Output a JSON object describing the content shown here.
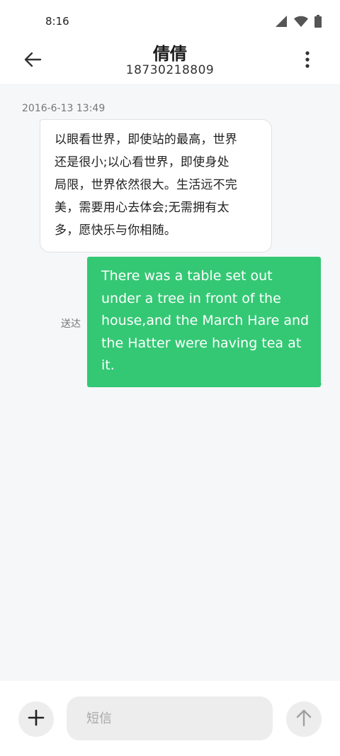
{
  "status_bar": {
    "time": "8:16",
    "icons": [
      "signal-icon",
      "wifi-icon",
      "battery-icon"
    ]
  },
  "header": {
    "contact_name": "倩倩",
    "phone_number": "18730218809",
    "back_icon": "arrow-left-icon",
    "more_icon": "more-vertical-icon"
  },
  "conversation": {
    "messages": [
      {
        "direction": "incoming",
        "timestamp": "2016-6-13 13:49",
        "lines": [
          "以眼看世界，即使站的最高，世界",
          "还是很小;以心看世界，即使身处",
          "局限，世界依然很大。生活远不完",
          "美，需要用心去体会;无需拥有太",
          "多，愿快乐与你相随。"
        ]
      },
      {
        "direction": "outgoing",
        "status": "送达",
        "lines": [
          "There was a table set out",
          "under a tree in front of the",
          "house,and the March Hare and",
          "the Hatter were having tea at",
          "it."
        ]
      }
    ]
  },
  "composer": {
    "placeholder": "短信",
    "value": "",
    "add_icon": "plus-icon",
    "send_icon": "arrow-up-icon"
  },
  "colors": {
    "accent": "#34c874",
    "background": "#f6f7f9",
    "surface": "#ffffff",
    "input_fill": "#ededed"
  }
}
